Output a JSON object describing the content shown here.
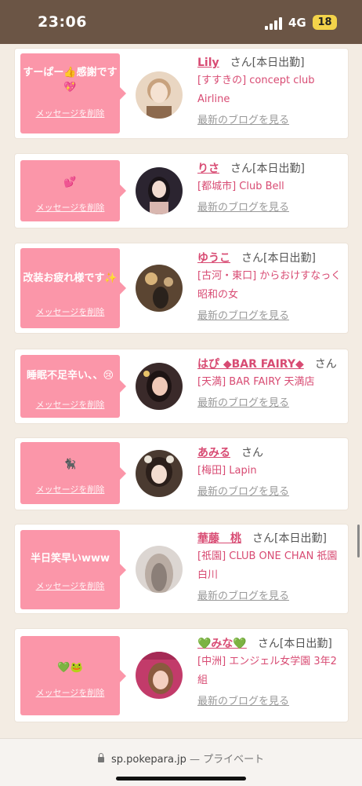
{
  "status_bar": {
    "time": "23:06",
    "network": "4G",
    "battery": "18"
  },
  "cards": [
    {
      "message": "すーぱー👍感謝です💖",
      "delete_label": "メッセージを削除",
      "name": "Lily",
      "honorific": "さん",
      "tag": "[本日出勤]",
      "shop": "[すすきの] concept club Airline",
      "blog_label": "最新のブログを見る",
      "avatar_colors": [
        "#e9d6c2",
        "#8d6a4e"
      ]
    },
    {
      "message": "💕",
      "delete_label": "メッセージを削除",
      "name": "りさ",
      "honorific": "さん",
      "tag": "[本日出勤]",
      "shop": "[都城市] Club Bell",
      "blog_label": "最新のブログを見る",
      "avatar_colors": [
        "#2b2430",
        "#f2dcd0"
      ]
    },
    {
      "message": "改装お疲れ様です✨",
      "delete_label": "メッセージを削除",
      "name": "ゆうこ",
      "honorific": "さん",
      "tag": "[本日出勤]",
      "shop": "[古河・東口] からおけすなっく 昭和の女",
      "blog_label": "最新のブログを見る",
      "avatar_colors": [
        "#5b4532",
        "#c9a97c"
      ]
    },
    {
      "message": "睡眠不足辛い、、😢",
      "delete_label": "メッセージを削除",
      "name": "はぴ ◆BAR FAIRY◆",
      "honorific": "さん",
      "tag": "",
      "shop": "[天満] BAR FAIRY 天満店",
      "blog_label": "最新のブログを見る",
      "avatar_colors": [
        "#3a2a2a",
        "#f0c9b8"
      ]
    },
    {
      "message": "🐈‍⬛",
      "delete_label": "メッセージを削除",
      "name": "あみる",
      "honorific": "さん",
      "tag": "",
      "shop": "[梅田] Lapin",
      "blog_label": "最新のブログを見る",
      "avatar_colors": [
        "#4a3a30",
        "#f3ddd0"
      ]
    },
    {
      "message": "半日笑早いwww",
      "delete_label": "メッセージを削除",
      "name": "華藤　桃",
      "honorific": "さん",
      "tag": "[本日出勤]",
      "shop": "[祇園] CLUB ONE CHAN 祇園白川",
      "blog_label": "最新のブログを見る",
      "avatar_colors": [
        "#c9bfb8",
        "#8b7f78"
      ]
    },
    {
      "message": "💚🐸",
      "delete_label": "メッセージを削除",
      "name": "💚みな💚",
      "honorific": "さん",
      "tag": "[本日出勤]",
      "shop": "[中洲] エンジェル女学園 3年2組",
      "blog_label": "最新のブログを見る",
      "avatar_colors": [
        "#c23b6a",
        "#f4cfc0"
      ]
    }
  ],
  "browser": {
    "domain": "sp.pokepara.jp",
    "mode": "— プライベート"
  }
}
